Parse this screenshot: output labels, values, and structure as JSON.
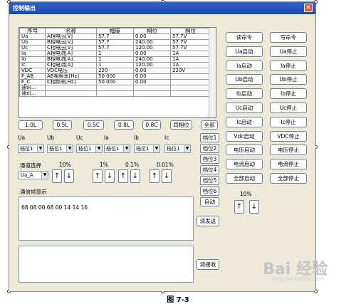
{
  "window": {
    "title": "控制输出",
    "close": "✕"
  },
  "table": {
    "headers": [
      "序号",
      "名称",
      "幅度",
      "相位",
      "档位"
    ],
    "rows": [
      [
        "Ua",
        "A相电压[V]",
        "57.7",
        "0.00",
        "57.7V"
      ],
      [
        "Ub",
        "B相电压[V]",
        "57.7",
        "240.00",
        "57.7V"
      ],
      [
        "Uc",
        "C相电压[V]",
        "57.7",
        "120.00",
        "57.7V"
      ],
      [
        "Ia",
        "A相电流[A]",
        "1",
        "0.00",
        "1A"
      ],
      [
        "Ib",
        "B相电流[A]",
        "1",
        "240.00",
        "1A"
      ],
      [
        "Ic",
        "C相电流[A]",
        "1",
        "120.00",
        "1A"
      ],
      [
        "VDC",
        "VDC电压",
        "220",
        "0.00",
        "220V"
      ],
      [
        "F_AB",
        "AB相频率[Hz]",
        "50.000",
        "0.00",
        ""
      ],
      [
        "F_C",
        "C相频率[Hz]",
        "50.000",
        "0.00",
        ""
      ],
      [
        "通讯...",
        "",
        "",
        "",
        ""
      ],
      [
        "通讯...",
        "",
        "",
        "",
        ""
      ]
    ]
  },
  "range_buttons": [
    "1.0L",
    "0.5L",
    "0.5C",
    "0.8L",
    "0.8C",
    "同相位",
    "全部"
  ],
  "channel_labels": [
    "Ua",
    "Ub",
    "Uc",
    "Ia",
    "Ib",
    "Ic"
  ],
  "channel_select_value": "档位1",
  "gear_buttons": [
    "档位1",
    "档位2",
    "档位3",
    "档位4",
    "档位5",
    "档位6",
    "自动"
  ],
  "channel_select": {
    "label": "通道选择",
    "value": "Ua_A"
  },
  "steps": [
    "10%",
    "1%",
    "0.1%",
    "0.01%"
  ],
  "right_step": "10%",
  "arrows": {
    "up": "↑",
    "down": "↓"
  },
  "comm": {
    "label": "通信帧显示",
    "content": "68 08 00 68 00 14 14 16",
    "clear_send": "清发送",
    "clear_recv": "清接收"
  },
  "right_buttons": [
    [
      "读命令",
      "写命令"
    ],
    [
      "Ua启动",
      "Ua停止"
    ],
    [
      "Ia启动",
      "Ia停止"
    ],
    [
      "Ub启动",
      "Ub停止"
    ],
    [
      "Ib启动",
      "Ib停止"
    ],
    [
      "Uc启动",
      "Uc停止"
    ],
    [
      "Ic启动",
      "Ic停止"
    ],
    [
      "Vdc启动",
      "VDC停止"
    ],
    [
      "电压启动",
      "电压停止"
    ],
    [
      "电流启动",
      "电流停止"
    ],
    [
      "全部启动",
      "全部停止"
    ]
  ],
  "caption": "图 7-3",
  "watermark": {
    "brand": "Bai 经验",
    "url": "jingyan.baidu.com"
  }
}
